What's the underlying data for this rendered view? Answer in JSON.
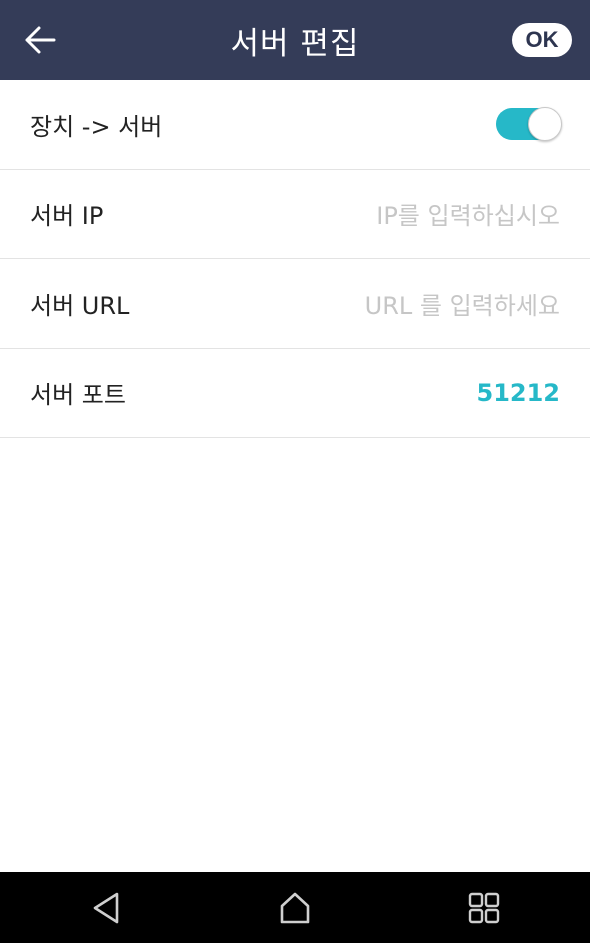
{
  "header": {
    "title": "서버 편집",
    "ok_label": "OK"
  },
  "rows": [
    {
      "label": "장치 -> 서버",
      "toggle_on": true
    },
    {
      "label": "서버 IP",
      "placeholder": "IP를 입력하십시오"
    },
    {
      "label": "서버 URL",
      "placeholder": "URL 를 입력하세요"
    },
    {
      "label": "서버 포트",
      "value": "51212"
    }
  ],
  "colors": {
    "header_bg": "#343c58",
    "accent": "#26b8c8",
    "toggle_on": "#26b8c8"
  },
  "icons": {
    "back": "arrow-left-icon",
    "nav_back": "triangle-back-icon",
    "nav_home": "home-icon",
    "nav_recent": "grid-icon"
  }
}
